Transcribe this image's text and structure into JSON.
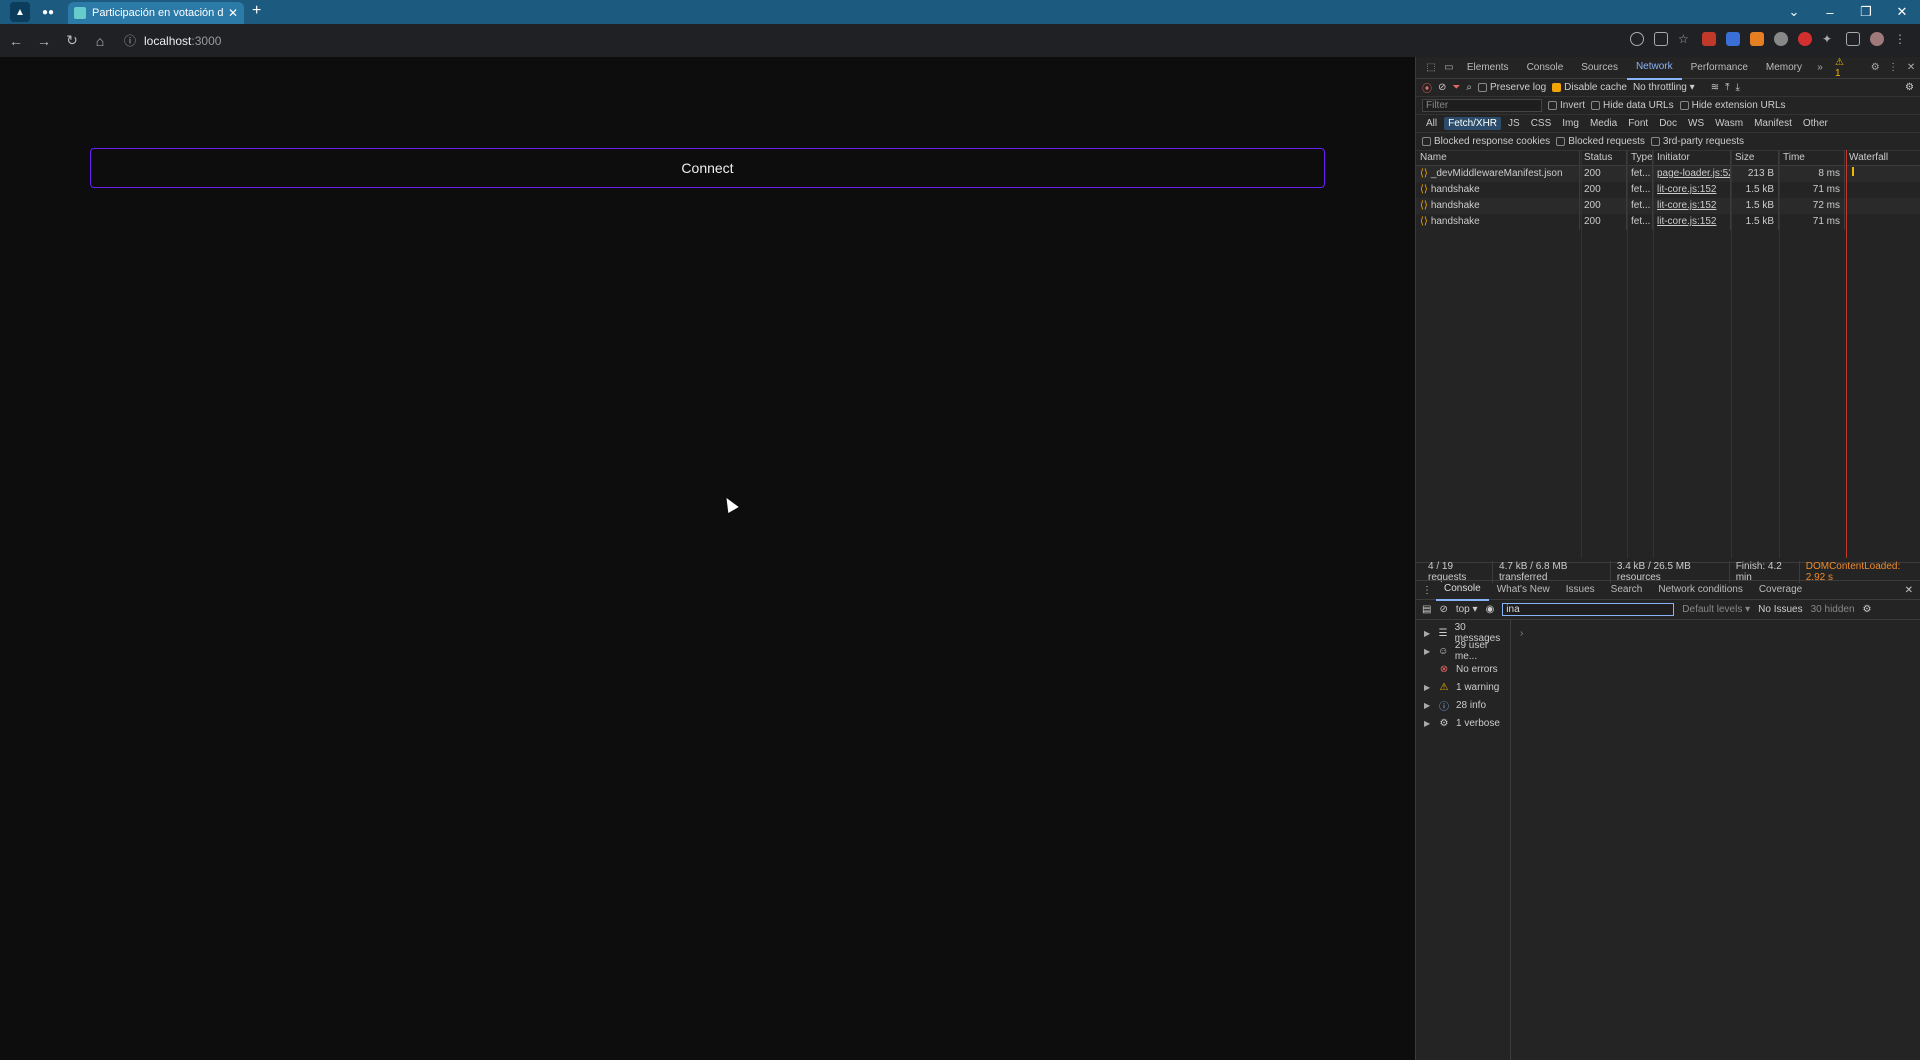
{
  "browser": {
    "tab_title": "Participación en votación de go",
    "url_host": "localhost",
    "url_port": ":3000"
  },
  "page": {
    "connect_label": "Connect"
  },
  "devtools": {
    "tabs": [
      "Elements",
      "Console",
      "Sources",
      "Network",
      "Performance",
      "Memory"
    ],
    "active_tab": "Network",
    "warning_count": "1",
    "toolbar": {
      "preserve_log": "Preserve log",
      "disable_cache": "Disable cache",
      "throttling": "No throttling"
    },
    "filter_placeholder": "Filter",
    "filter_opts": {
      "invert": "Invert",
      "hide_data": "Hide data URLs",
      "hide_ext": "Hide extension URLs"
    },
    "chips": [
      "All",
      "Fetch/XHR",
      "JS",
      "CSS",
      "Img",
      "Media",
      "Font",
      "Doc",
      "WS",
      "Wasm",
      "Manifest",
      "Other"
    ],
    "blocked": {
      "cookies": "Blocked response cookies",
      "requests": "Blocked requests",
      "third": "3rd-party requests"
    },
    "columns": [
      "Name",
      "Status",
      "Type",
      "Initiator",
      "Size",
      "Time",
      "Waterfall"
    ],
    "rows": [
      {
        "name": "_devMiddlewareManifest.json",
        "status": "200",
        "type": "fet...",
        "initiator": "page-loader.js:52",
        "size": "213 B",
        "time": "8 ms"
      },
      {
        "name": "handshake",
        "status": "200",
        "type": "fet...",
        "initiator": "lit-core.js:152",
        "size": "1.5 kB",
        "time": "71 ms"
      },
      {
        "name": "handshake",
        "status": "200",
        "type": "fet...",
        "initiator": "lit-core.js:152",
        "size": "1.5 kB",
        "time": "72 ms"
      },
      {
        "name": "handshake",
        "status": "200",
        "type": "fet...",
        "initiator": "lit-core.js:152",
        "size": "1.5 kB",
        "time": "71 ms"
      }
    ],
    "summary": {
      "requests": "4 / 19 requests",
      "transferred": "4.7 kB / 6.8 MB transferred",
      "resources": "3.4 kB / 26.5 MB resources",
      "finish": "Finish: 4.2 min",
      "dcl": "DOMContentLoaded: 2.92 s"
    },
    "drawer_tabs": [
      "Console",
      "What's New",
      "Issues",
      "Search",
      "Network conditions",
      "Coverage"
    ],
    "console": {
      "context": "top",
      "filter_value": "ina",
      "levels": "Default levels",
      "issues": "No Issues",
      "hidden": "30 hidden"
    },
    "sidebar": [
      {
        "label": "30 messages",
        "icon": "list-icon"
      },
      {
        "label": "29 user me...",
        "icon": "user-icon"
      },
      {
        "label": "No errors",
        "icon": "error-icon"
      },
      {
        "label": "1 warning",
        "icon": "warning-icon"
      },
      {
        "label": "28 info",
        "icon": "info-icon"
      },
      {
        "label": "1 verbose",
        "icon": "verbose-icon"
      }
    ]
  }
}
